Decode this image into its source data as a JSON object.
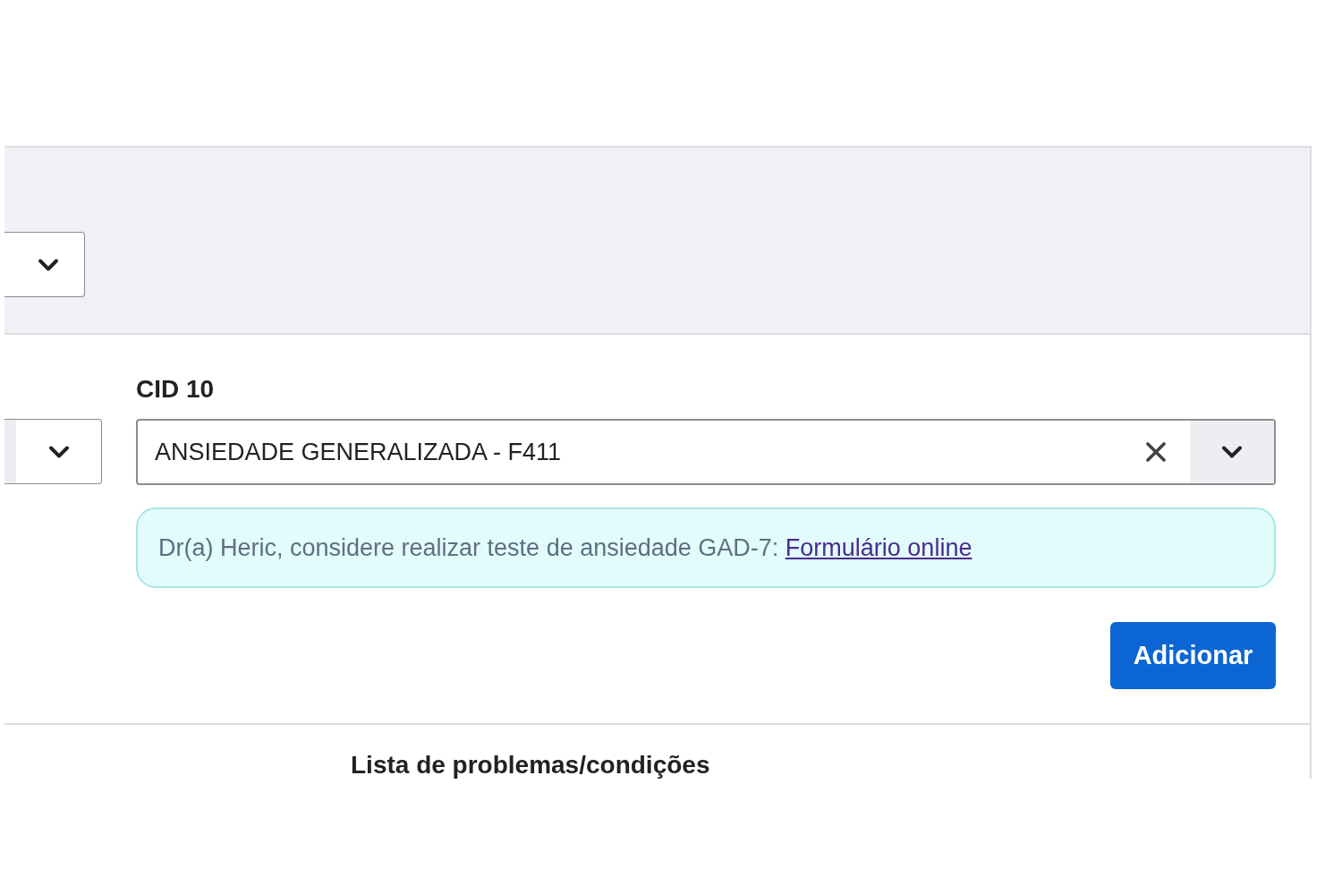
{
  "filter_bar": {
    "controls": [
      {
        "kind": "select"
      }
    ]
  },
  "form": {
    "left_select": {
      "kind": "select"
    },
    "cid10": {
      "label": "CID 10",
      "value": "ANSIEDADE GENERALIZADA - F411",
      "clearable": true
    },
    "alert": {
      "text": "Dr(a) Heric, considere realizar teste de ansiedade GAD-7:",
      "link": "Formulário online"
    },
    "button": "Adicionar"
  },
  "section_title": "Lista de problemas/condições"
}
